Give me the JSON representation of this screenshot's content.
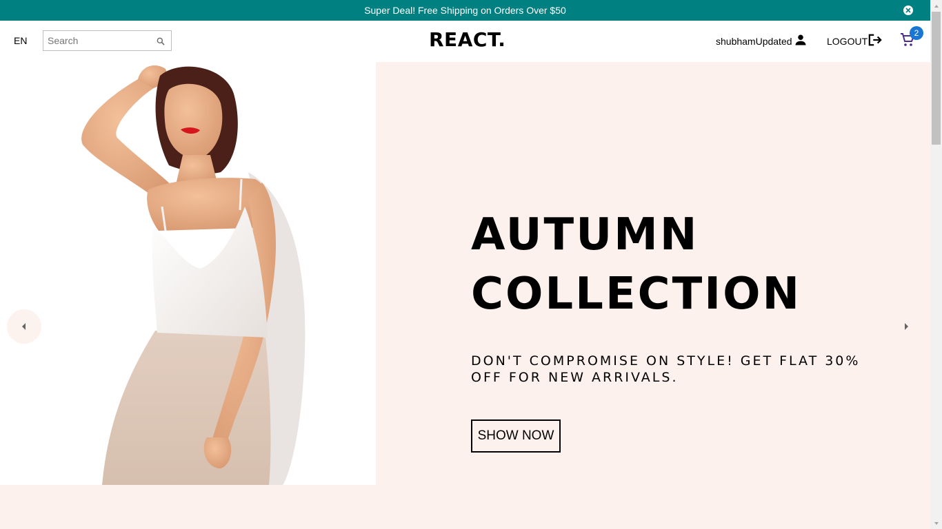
{
  "announcement": {
    "text": "Super Deal! Free Shipping on Orders Over $50",
    "close_icon": "close-circle-icon"
  },
  "navbar": {
    "language": "EN",
    "search": {
      "placeholder": "Search",
      "value": "",
      "icon": "search-icon"
    },
    "logo": "REACT.",
    "user": {
      "name": "shubhamUpdated",
      "icon": "person-icon"
    },
    "logout": {
      "label": "LOGOUT",
      "icon": "logout-icon"
    },
    "cart": {
      "count": "2",
      "icon": "cart-icon"
    }
  },
  "slider": {
    "background": "#fcf1ed",
    "slides": [
      {
        "image": "woman-in-white-satin-top-photo",
        "title": "AUTUMN\nCOLLECTION",
        "description": "DON'T COMPROMISE ON STYLE! GET FLAT 30% OFF FOR NEW ARRIVALS.",
        "button_label": "SHOW NOW"
      }
    ],
    "prev_icon": "arrow-left-icon",
    "next_icon": "arrow-right-icon"
  },
  "colors": {
    "announcement_bg": "#008080",
    "badge": "#1976d2",
    "slide_bg": "#fcf1ed"
  }
}
